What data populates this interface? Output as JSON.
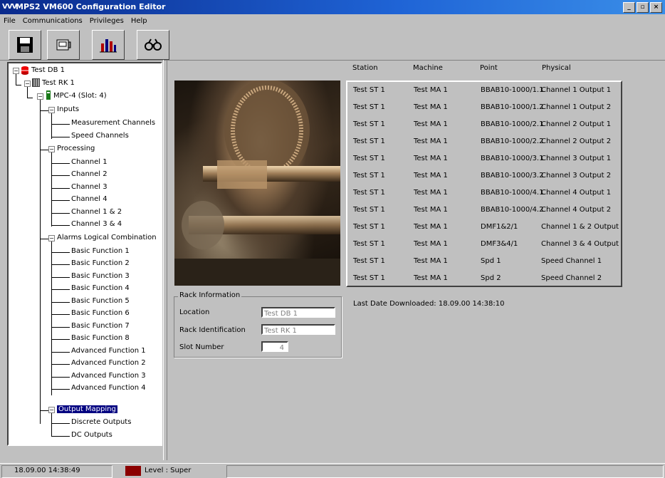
{
  "window": {
    "title": "MPS2 VM600 Configuration Editor",
    "logo": "VVV"
  },
  "menu": [
    "File",
    "Communications",
    "Privileges",
    "Help"
  ],
  "toolbar": [
    {
      "icon": "save-icon"
    },
    {
      "icon": "device-icon"
    },
    {
      "icon": "bar-chart-icon"
    },
    {
      "icon": "binoculars-icon"
    }
  ],
  "tree": {
    "db": "Test DB 1",
    "rack": "Test RK 1",
    "card": "MPC-4 (Slot:  4)",
    "inputs": {
      "label": "Inputs",
      "items": [
        "Measurement Channels",
        "Speed Channels"
      ]
    },
    "processing": {
      "label": "Processing",
      "items": [
        "Channel 1",
        "Channel 2",
        "Channel 3",
        "Channel 4",
        "Channel 1 & 2",
        "Channel 3 & 4"
      ]
    },
    "alarms": {
      "label": "Alarms Logical Combination",
      "items": [
        "Basic Function 1",
        "Basic Function 2",
        "Basic Function 3",
        "Basic Function 4",
        "Basic Function 5",
        "Basic Function 6",
        "Basic Function 7",
        "Basic Function 8",
        "Advanced Function 1",
        "Advanced Function 2",
        "Advanced Function 3",
        "Advanced Function 4"
      ]
    },
    "output": {
      "label": "Output Mapping",
      "items": [
        "Discrete Outputs",
        "DC Outputs"
      ]
    }
  },
  "rack_info": {
    "title": "Rack Information",
    "location_label": "Location",
    "location_value": "Test DB 1",
    "rackid_label": "Rack Identification",
    "rackid_value": "Test RK 1",
    "slot_label": "Slot Number",
    "slot_value": "4"
  },
  "table": {
    "headers": [
      "Station",
      "Machine",
      "Point",
      "Physical"
    ],
    "rows": [
      [
        "Test ST 1",
        "Test MA 1",
        "BBAB10-1000/1.1",
        "Channel 1 Output 1"
      ],
      [
        "Test ST 1",
        "Test MA 1",
        "BBAB10-1000/1.2",
        "Channel 1 Output 2"
      ],
      [
        "Test ST 1",
        "Test MA 1",
        "BBAB10-1000/2.1",
        "Channel 2 Output 1"
      ],
      [
        "Test ST 1",
        "Test MA 1",
        "BBAB10-1000/2.2",
        "Channel 2 Output 2"
      ],
      [
        "Test ST 1",
        "Test MA 1",
        "BBAB10-1000/3.1",
        "Channel 3 Output 1"
      ],
      [
        "Test ST 1",
        "Test MA 1",
        "BBAB10-1000/3.2",
        "Channel 3 Output 2"
      ],
      [
        "Test ST 1",
        "Test MA 1",
        "BBAB10-1000/4.1",
        "Channel 4 Output 1"
      ],
      [
        "Test ST 1",
        "Test MA 1",
        "BBAB10-1000/4.2",
        "Channel 4 Output 2"
      ],
      [
        "Test ST 1",
        "Test MA 1",
        "DMF1&2/1",
        "Channel 1 & 2 Output"
      ],
      [
        "Test ST 1",
        "Test MA 1",
        "DMF3&4/1",
        "Channel 3 & 4 Output"
      ],
      [
        "Test ST 1",
        "Test MA 1",
        "Spd 1",
        "Speed Channel 1"
      ],
      [
        "Test ST 1",
        "Test MA 1",
        "Spd 2",
        "Speed Channel 2"
      ]
    ]
  },
  "last_download": "Last Date Downloaded:  18.09.00 14:38:10",
  "status": {
    "datetime": "18.09.00 14:38:49",
    "level": "Level : Super",
    "level_color": "#8b0000"
  },
  "colors": {
    "title_bar": "#0a2a8c",
    "selection": "#000080",
    "face": "#c0c0c0"
  }
}
